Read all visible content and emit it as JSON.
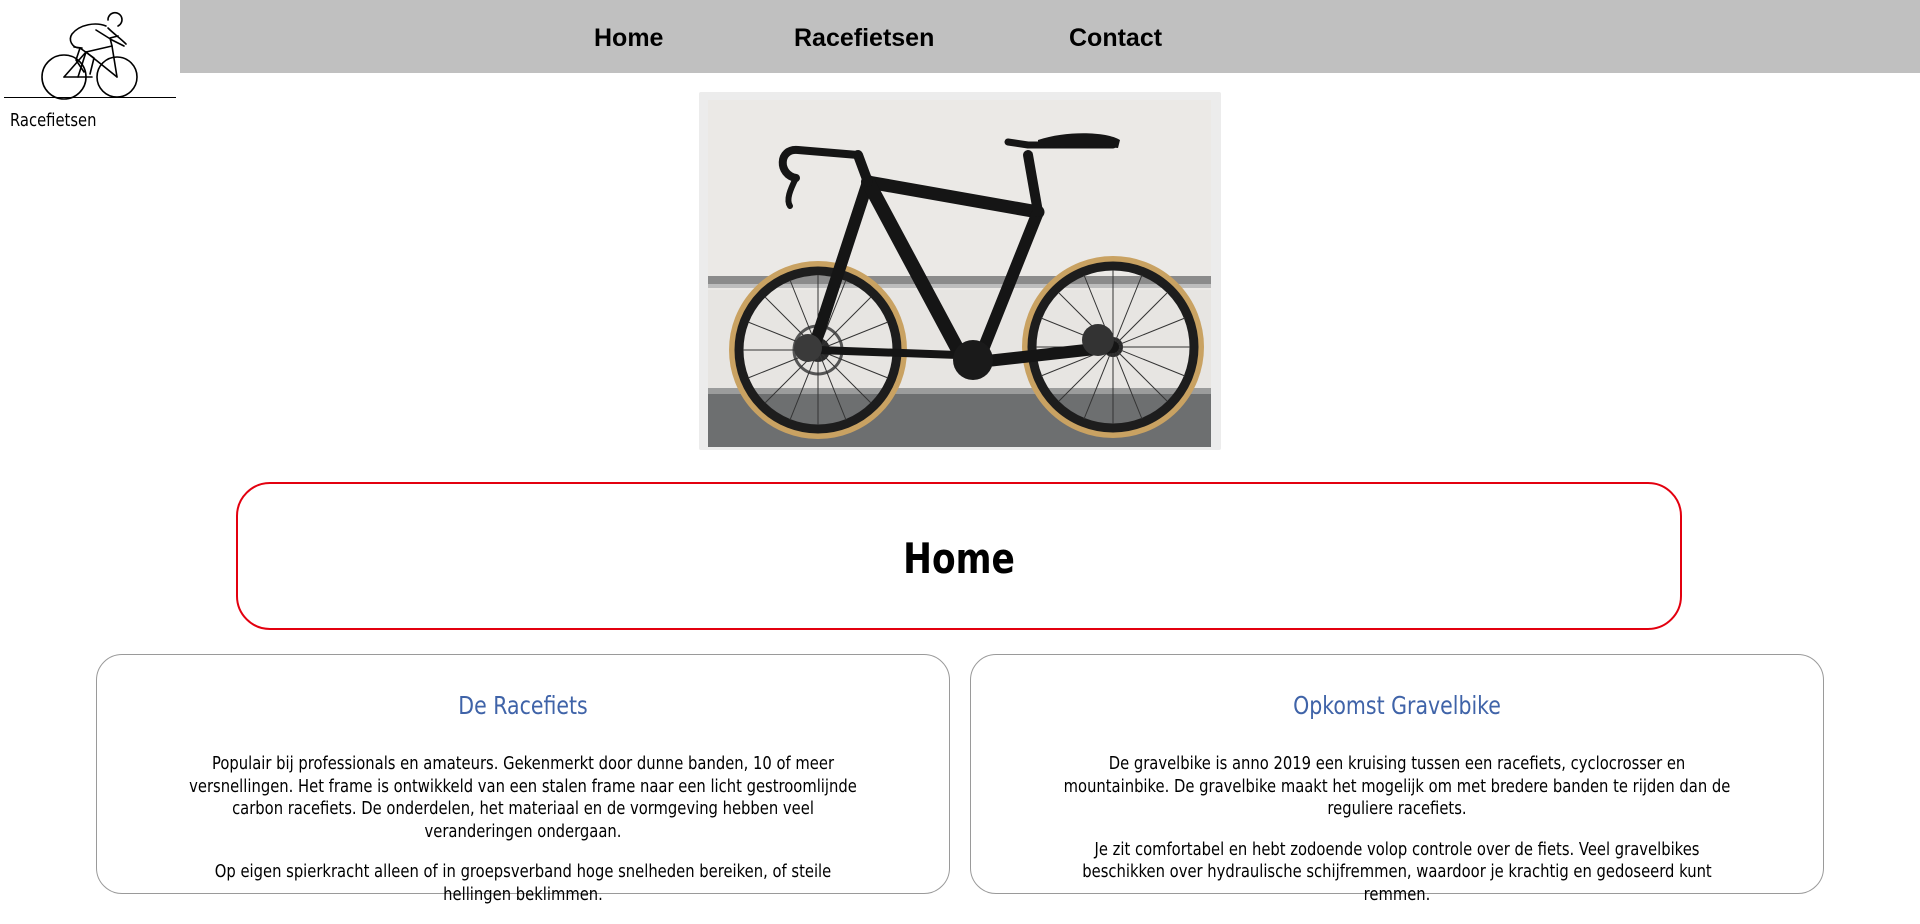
{
  "logo": {
    "label": "Racefietsen",
    "icon": "cyclist-icon"
  },
  "nav": {
    "items": [
      {
        "label": "Home"
      },
      {
        "label": "Racefietsen"
      },
      {
        "label": "Contact"
      }
    ]
  },
  "hero": {
    "image": "road-bike-photo"
  },
  "page": {
    "title": "Home"
  },
  "cards": [
    {
      "title": "De Racefiets",
      "paragraphs": [
        "Populair bij professionals en amateurs. Gekenmerkt door dunne banden, 10 of meer versnellingen. Het frame is ontwikkeld van een stalen frame naar een licht gestroomlijnde carbon racefiets. De onderdelen, het materiaal en de vormgeving hebben veel veranderingen ondergaan.",
        "Op eigen spierkracht alleen of in groepsverband hoge snelheden bereiken, of steile hellingen beklimmen."
      ]
    },
    {
      "title": "Opkomst Gravelbike",
      "paragraphs": [
        "De gravelbike is anno 2019 een kruising tussen een racefiets, cyclocrosser en mountainbike. De gravelbike maakt het mogelijk om met bredere banden te rijden dan de reguliere racefiets.",
        "Je zit comfortabel en hebt zodoende volop controle over de fiets. Veel gravelbikes beschikken over hydraulische schijfremmen, waardoor je krachtig en gedoseerd kunt remmen."
      ]
    }
  ],
  "colors": {
    "nav_bg": "#c0c0c0",
    "title_border": "#e3000f",
    "card_heading": "#3f63a8"
  }
}
